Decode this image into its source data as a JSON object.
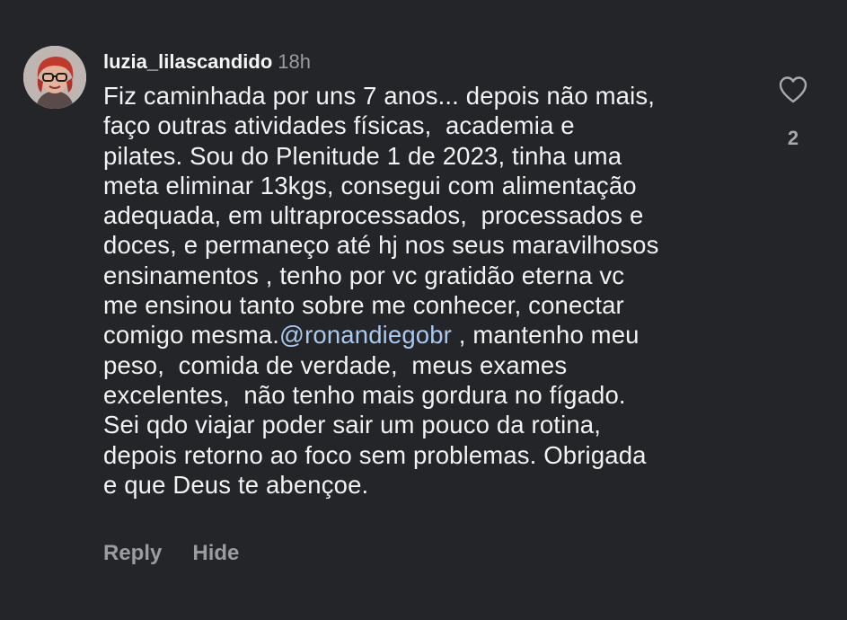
{
  "comment": {
    "username": "luzia_lilascandido",
    "timestamp": "18h",
    "lines": [
      "Fiz caminhada por uns 7 anos... depois não mais,",
      "faço outras atividades físicas,  academia e",
      "pilates. Sou do Plenitude 1 de 2023, tinha uma",
      "meta eliminar 13kgs, consegui com alimentação",
      "adequada, em ultraprocessados,  processados e",
      "doces, e permaneço até hj nos seus maravilhosos",
      "ensinamentos , tenho por vc gratidão eterna vc",
      "me ensinou tanto sobre me conhecer, conectar"
    ],
    "mention_line": {
      "before": "comigo mesma.",
      "mention": "@ronandiegobr",
      "after": " , mantenho meu"
    },
    "lines_after": [
      "peso,  comida de verdade,  meus exames",
      "excelentes,  não tenho mais gordura no fígado.",
      "Sei qdo viajar poder sair um pouco da rotina,",
      "depois retorno ao foco sem problemas. Obrigada",
      "e que Deus te abençoe."
    ],
    "like_count": "2",
    "reply_label": "Reply",
    "hide_label": "Hide"
  },
  "colors": {
    "background": "#232528",
    "text": "#f2f2f2",
    "muted": "#9a9ca1",
    "mention": "#a9c9ef"
  },
  "icons": {
    "avatar": "avatar",
    "like": "heart-outline-icon"
  }
}
